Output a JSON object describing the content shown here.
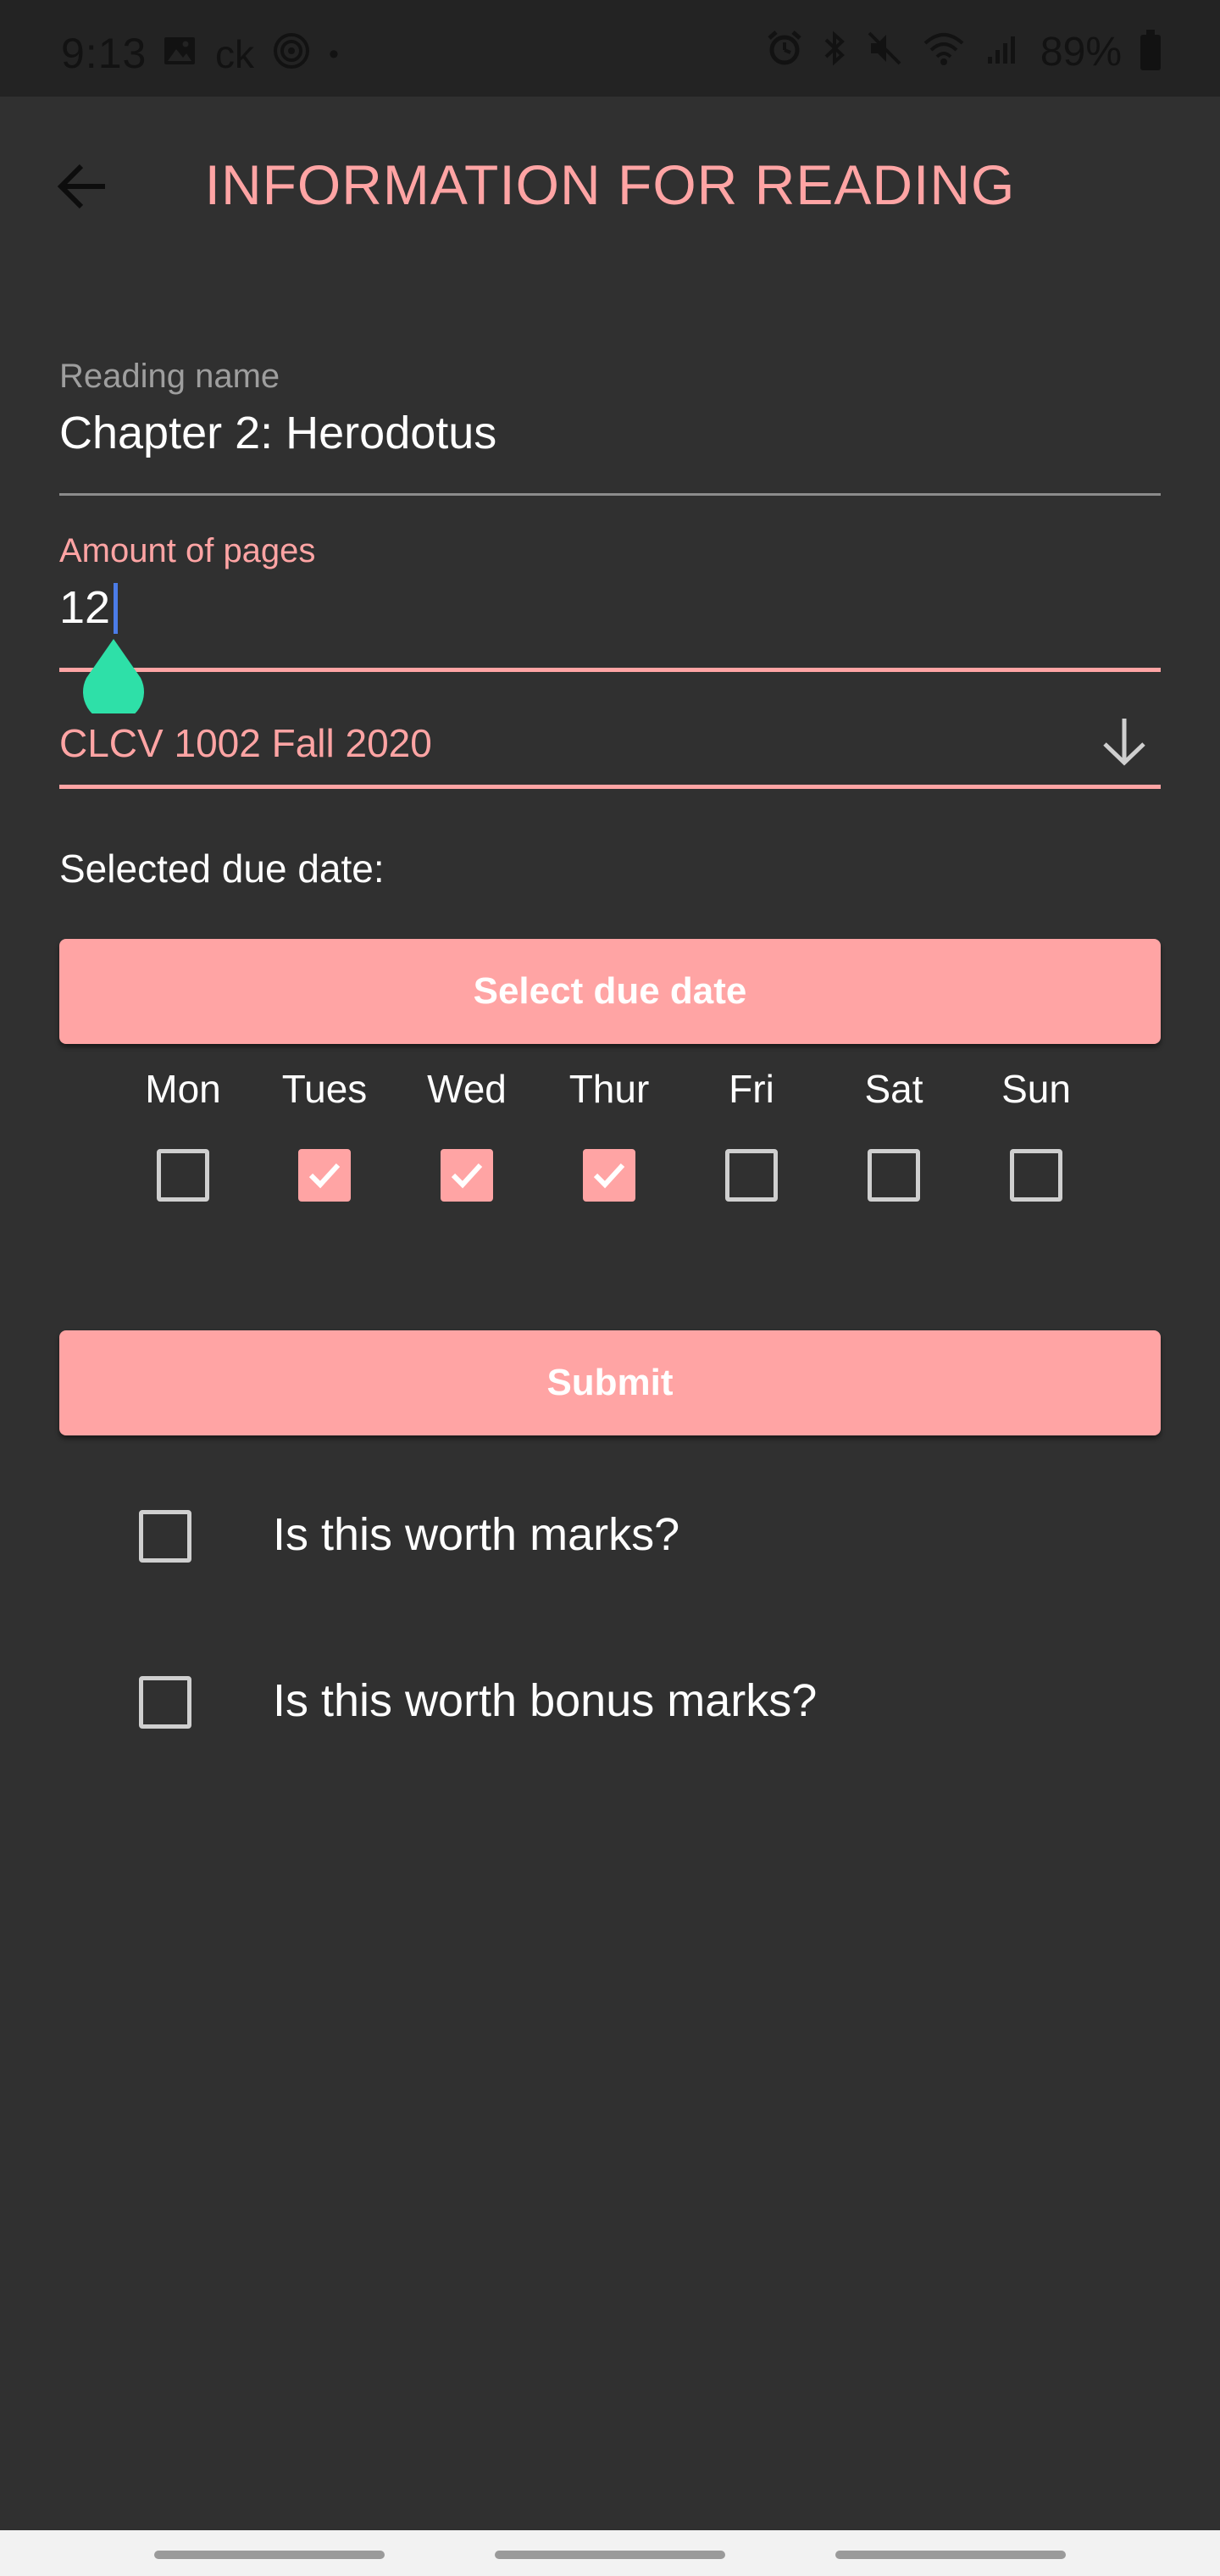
{
  "status_bar": {
    "time": "9:13",
    "carrier_text": "ck",
    "dot": "•",
    "battery": "89%",
    "left_icons": [
      "image-icon",
      "at-sign-icon"
    ],
    "right_icons": [
      "alarm-icon",
      "bluetooth-icon",
      "mute-icon",
      "wifi-icon",
      "signal-icon",
      "battery-icon"
    ]
  },
  "header": {
    "title": "INFORMATION FOR READING",
    "back_icon": "arrow-left-icon"
  },
  "form": {
    "reading_name": {
      "label": "Reading name",
      "value": "Chapter 2: Herodotus"
    },
    "pages": {
      "label": "Amount of pages",
      "value": "12"
    },
    "course": {
      "value": "CLCV 1002 Fall 2020",
      "icon": "arrow-down-icon"
    },
    "due_date_label": "Selected due date:",
    "select_due_date_label": "Select due date",
    "days": [
      {
        "name": "Mon",
        "checked": false
      },
      {
        "name": "Tues",
        "checked": true
      },
      {
        "name": "Wed",
        "checked": true
      },
      {
        "name": "Thur",
        "checked": true
      },
      {
        "name": "Fri",
        "checked": false
      },
      {
        "name": "Sat",
        "checked": false
      },
      {
        "name": "Sun",
        "checked": false
      }
    ],
    "submit_label": "Submit",
    "worth_marks_label": "Is this worth marks?",
    "worth_marks_checked": false,
    "bonus_marks_label": "Is this worth bonus marks?",
    "bonus_marks_checked": false
  },
  "colors": {
    "accent": "#ffa4a4",
    "background": "#303030",
    "status_bar": "#232323",
    "slider_thumb": "#2ee0a8",
    "cursor": "#4b7ce8"
  }
}
